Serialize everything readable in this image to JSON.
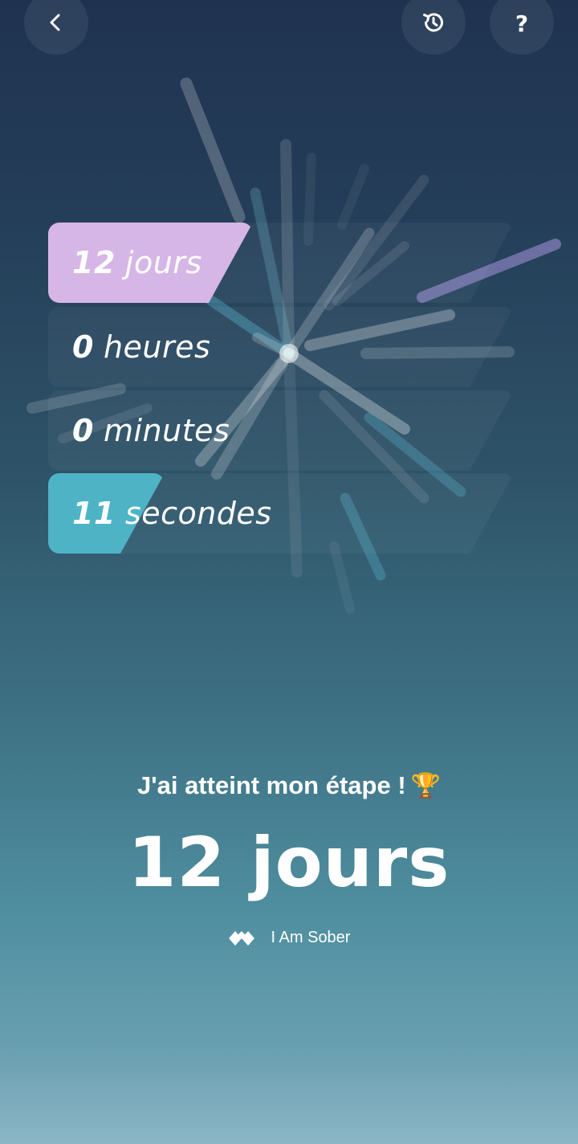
{
  "header": {
    "back_icon": "chevron-left-icon",
    "history_icon": "history-icon",
    "help_label": "?"
  },
  "counters": [
    {
      "value": "12",
      "unit": "jours",
      "fill_fraction": 0.44,
      "color": "#d6b6e6"
    },
    {
      "value": "0",
      "unit": "heures",
      "fill_fraction": 0.0,
      "color": null
    },
    {
      "value": "0",
      "unit": "minutes",
      "fill_fraction": 0.0,
      "color": null
    },
    {
      "value": "11",
      "unit": "secondes",
      "fill_fraction": 0.25,
      "color": "#4fb3c6"
    }
  ],
  "milestone": {
    "title": "J'ai atteint mon étape !",
    "trophy": "🏆",
    "value": "12 jours"
  },
  "brand": {
    "logo_icon": "i-am-sober-logo-icon",
    "name": "I Am Sober"
  }
}
